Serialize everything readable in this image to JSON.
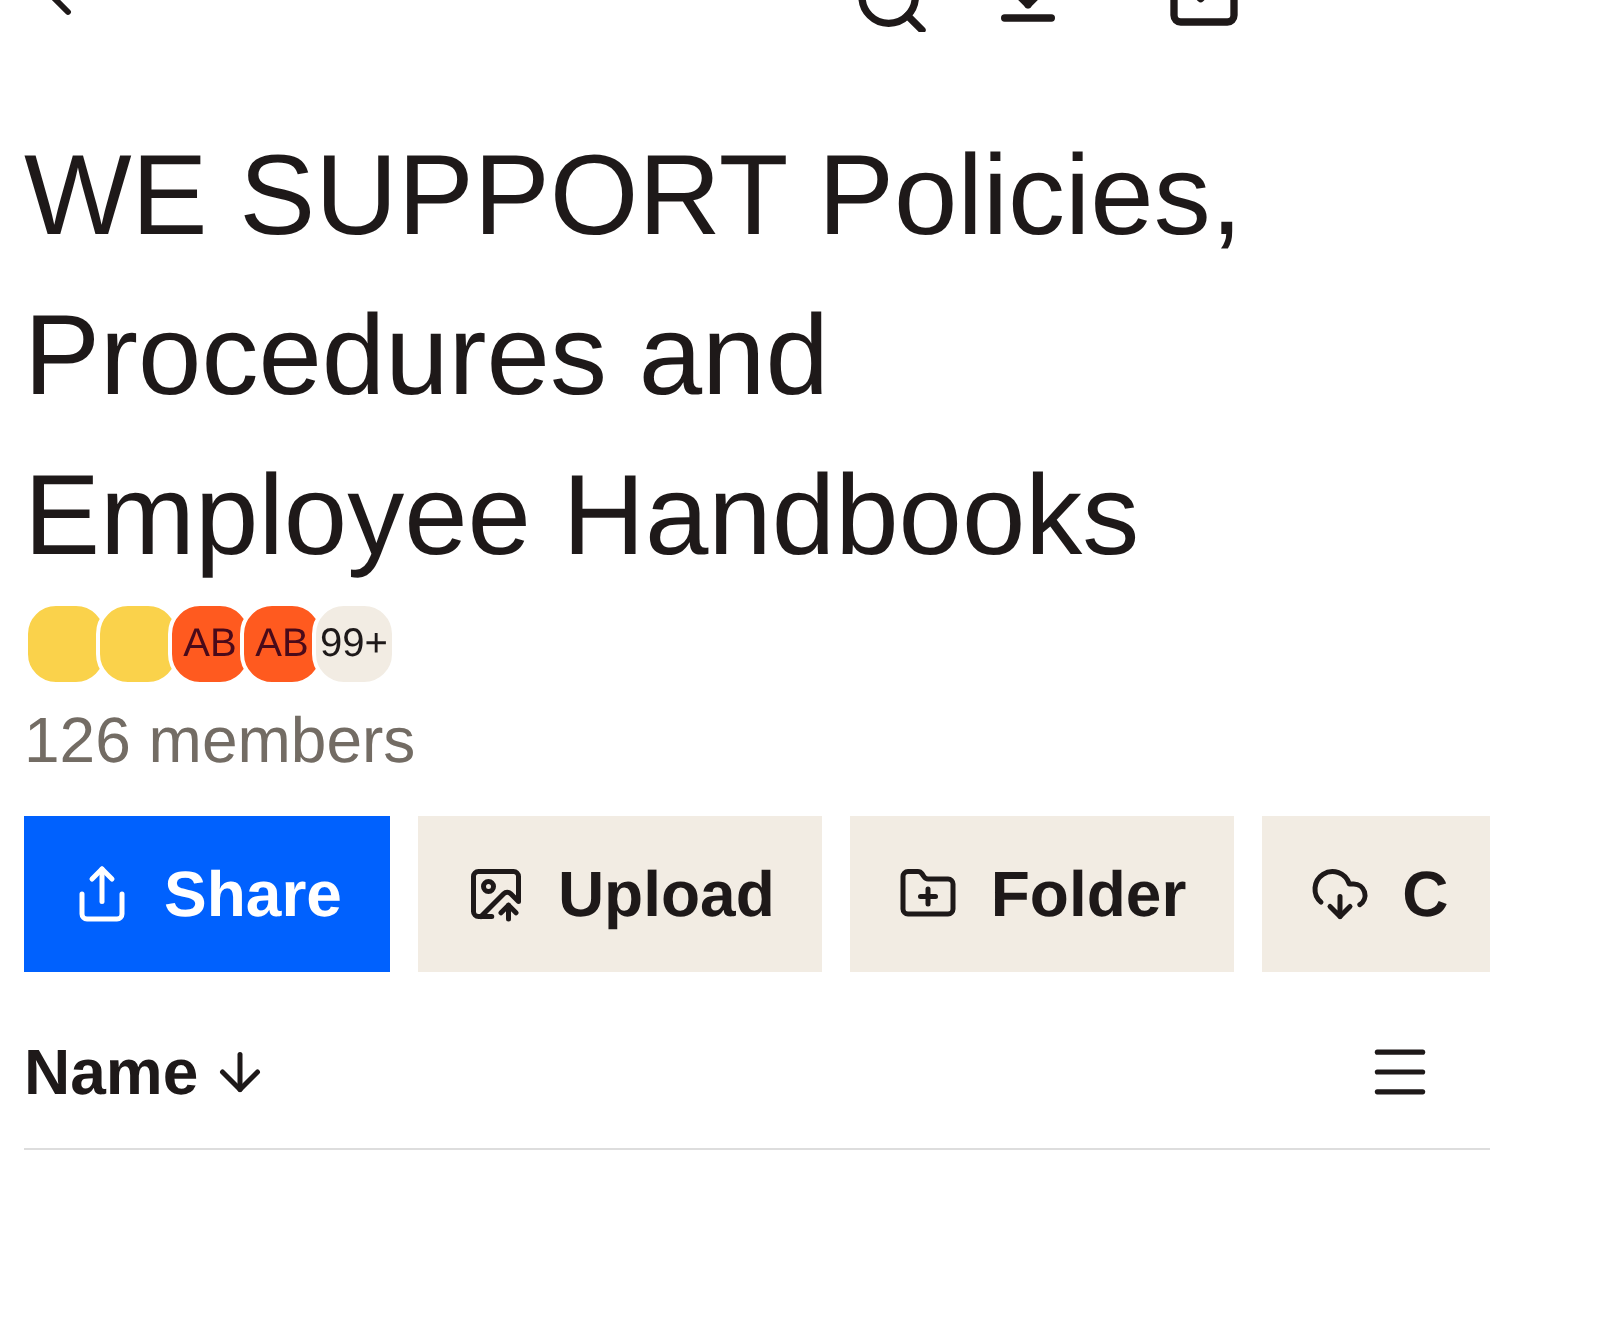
{
  "title": "WE SUPPORT Policies, Procedures and Employee Handbooks",
  "avatars": [
    {
      "kind": "blank",
      "color": "#fad24b"
    },
    {
      "kind": "blank",
      "color": "#fad24b"
    },
    {
      "kind": "initials",
      "color": "#ff5a1f",
      "text": "AB"
    },
    {
      "kind": "initials",
      "color": "#ff5a1f",
      "text": "AB"
    },
    {
      "kind": "count",
      "color": "#f2ece3",
      "text": "99+"
    }
  ],
  "members": "126 members",
  "actions": [
    {
      "label": "Share",
      "kind": "share",
      "primary": true
    },
    {
      "label": "Upload",
      "kind": "upload",
      "primary": false
    },
    {
      "label": "Folder",
      "kind": "folder",
      "primary": false
    },
    {
      "label": "C",
      "kind": "cloud",
      "primary": false
    }
  ],
  "sort": {
    "label": "Name"
  }
}
